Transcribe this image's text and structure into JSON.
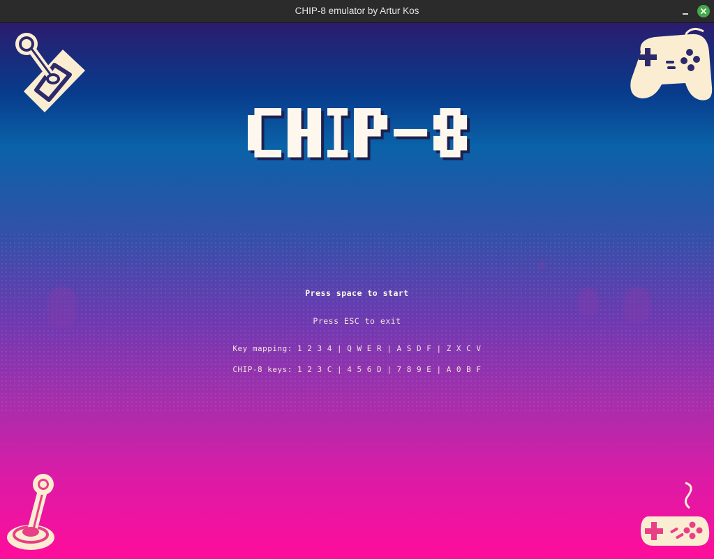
{
  "window": {
    "title": "CHIP-8 emulator by Artur Kos"
  },
  "screen": {
    "logo_text": "CHIP-8",
    "start_prompt": "Press space to start",
    "exit_prompt": "Press ESC to exit",
    "key_mapping": "Key mapping: 1 2 3 4 | Q W E R | A S D F | Z X C V",
    "chip8_keys": "CHIP-8 keys: 1 2 3 C | 4 5 6 D | 7 8 9 E | A 0 B F"
  },
  "colors": {
    "cream": "#fbedd2",
    "navy": "#2c2a6b",
    "top": "#2b1c6e",
    "bottom": "#ff0c9b"
  }
}
